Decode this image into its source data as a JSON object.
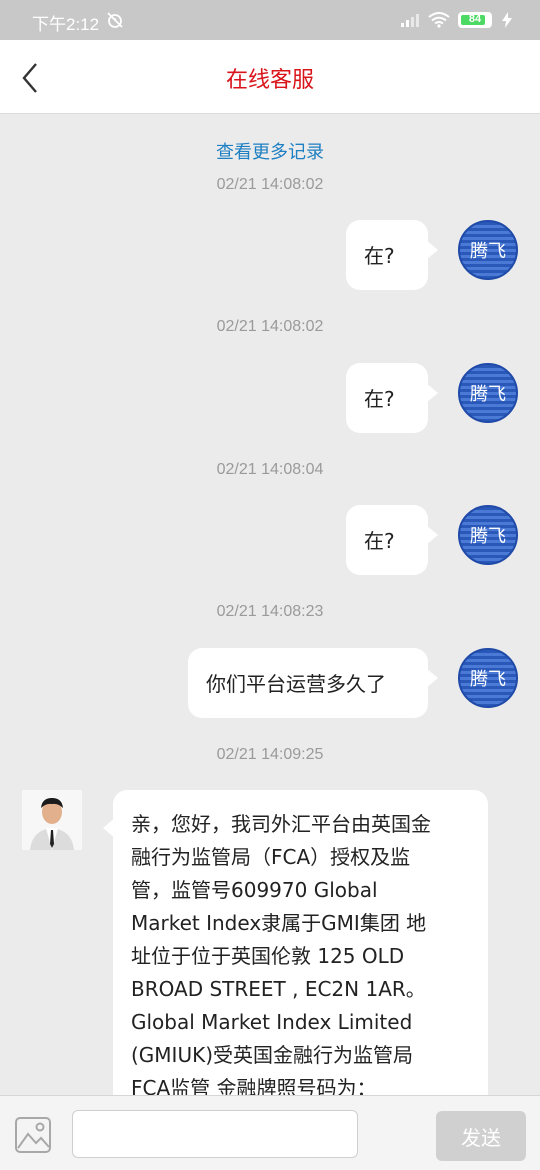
{
  "status_bar": {
    "time": "下午2:12",
    "battery": "84",
    "battery_level": 0.84
  },
  "header": {
    "title": "在线客服"
  },
  "chat": {
    "more_records": "查看更多记录",
    "user_avatar_text": "腾飞",
    "messages": [
      {
        "timestamp": "02/21 14:08:02",
        "sender": "user",
        "text": "在?"
      },
      {
        "timestamp": "02/21 14:08:02",
        "sender": "user",
        "text": "在?"
      },
      {
        "timestamp": "02/21 14:08:04",
        "sender": "user",
        "text": "在?"
      },
      {
        "timestamp": "02/21 14:08:23",
        "sender": "user",
        "text": "你们平台运营多久了"
      },
      {
        "timestamp": "02/21 14:09:25",
        "sender": "agent",
        "lines": [
          "亲，您好，我司外汇平台由英国金",
          "融行为监管局（FCA）授权及监",
          "管，监管号609970 Global",
          "Market Index隶属于GMI集团 地",
          "址位于位于英国伦敦 125 OLD",
          "BROAD STREET , EC2N 1AR。",
          "Global Market Index Limited",
          "(GMIUK)受英国金融行为监管局",
          "FCA监管 金融牌照号码为："
        ]
      }
    ]
  },
  "input_bar": {
    "placeholder": "",
    "send_label": "发送"
  }
}
